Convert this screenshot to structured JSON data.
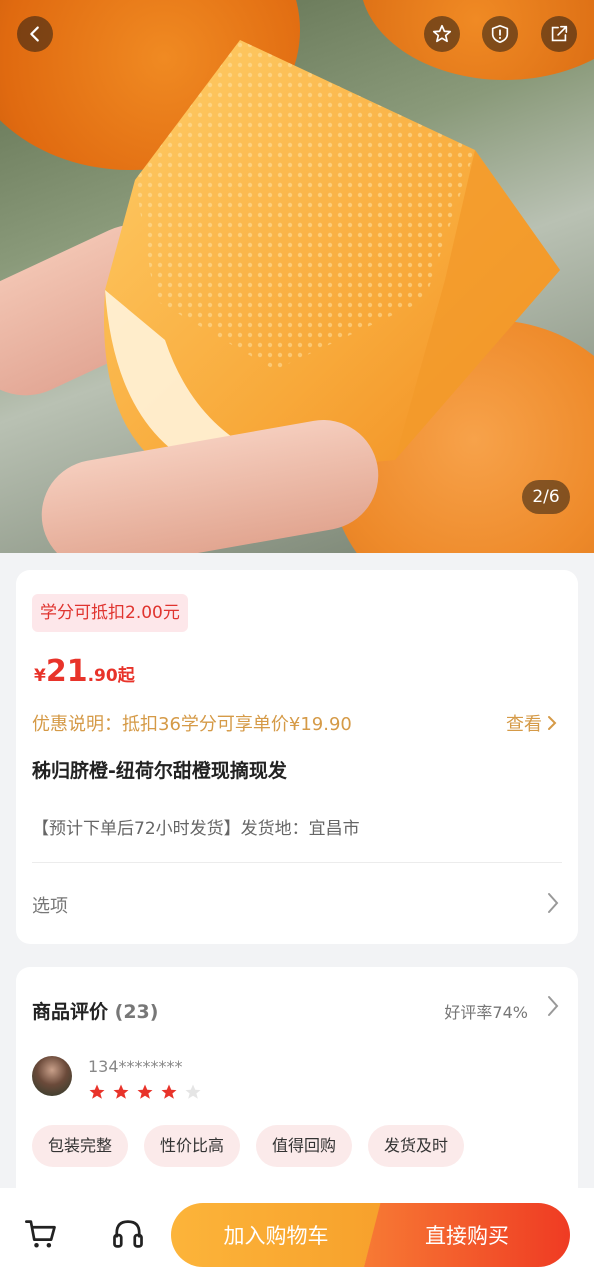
{
  "gallery": {
    "counter": "2/6"
  },
  "product": {
    "credit_badge": "学分可抵扣2.00元",
    "price": {
      "currency": "¥",
      "integer": "21",
      "decimal": ".90起"
    },
    "promo_text": "优惠说明：抵扣36学分可享单价¥19.90",
    "promo_more": "查看",
    "title": "秭归脐橙-纽荷尔甜橙现摘现发",
    "shipping": "【预计下单后72小时发货】发货地：宜昌市",
    "options_label": "选项"
  },
  "reviews": {
    "title": "商品评价",
    "count": "(23)",
    "positive_rate": "好评率74%",
    "first": {
      "username": "134********",
      "rating": 4,
      "rating_max": 5
    },
    "tags": [
      "包装完整",
      "性价比高",
      "值得回购",
      "发货及时"
    ]
  },
  "bottom": {
    "add_to_cart": "加入购物车",
    "buy_now": "直接购买"
  },
  "colors": {
    "accent_red": "#e8332a",
    "promo_gold": "#d59a47",
    "cart_orange": "#f7a12c",
    "buy_red": "#ef3b23"
  },
  "icons": [
    "back-icon",
    "favorite-star-icon",
    "report-icon",
    "share-icon",
    "chevron-right-icon",
    "cart-icon",
    "customer-service-icon"
  ]
}
